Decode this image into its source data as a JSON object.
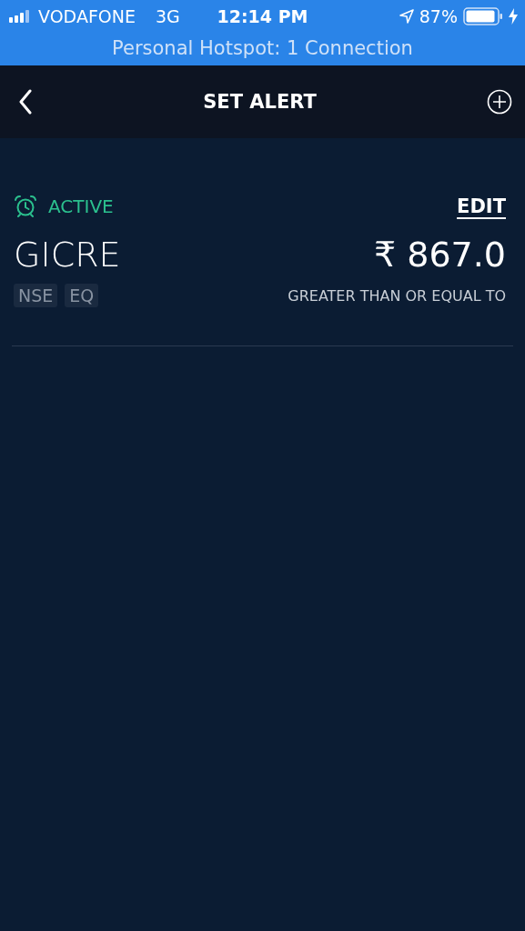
{
  "status_bar": {
    "carrier": "VODAFONE",
    "network": "3G",
    "time": "12:14 PM",
    "battery": "87%",
    "hotspot": "Personal Hotspot: 1 Connection"
  },
  "header": {
    "title": "SET ALERT"
  },
  "alerts": [
    {
      "status": "ACTIVE",
      "active": true,
      "edit": "EDIT",
      "symbol": "GICRE",
      "price": "₹ 867.0",
      "tags": [
        "NSE",
        "EQ"
      ],
      "condition": "GREATER THAN OR EQUAL TO"
    }
  ]
}
